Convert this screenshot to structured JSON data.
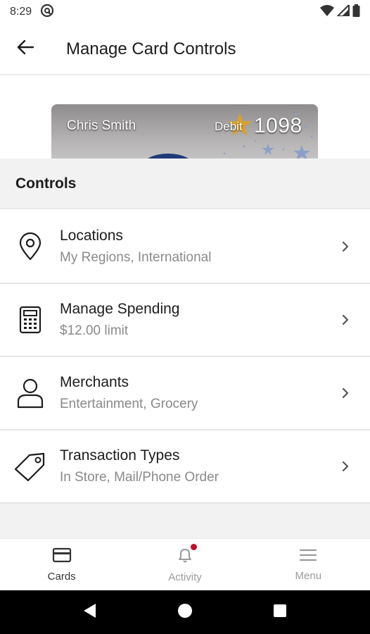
{
  "status_bar": {
    "time": "8:29"
  },
  "header": {
    "title": "Manage Card Controls"
  },
  "card": {
    "name": "Chris Smith",
    "type": "Debit",
    "last4": "1098"
  },
  "section": {
    "title": "Controls"
  },
  "controls": [
    {
      "title": "Locations",
      "subtitle": "My Regions, International",
      "icon": "location-pin-icon"
    },
    {
      "title": "Manage Spending",
      "subtitle": "$12.00 limit",
      "icon": "calculator-icon"
    },
    {
      "title": "Merchants",
      "subtitle": "Entertainment, Grocery",
      "icon": "person-icon"
    },
    {
      "title": "Transaction Types",
      "subtitle": "In Store, Mail/Phone Order",
      "icon": "tag-icon"
    }
  ],
  "bottom_nav": [
    {
      "label": "Cards",
      "icon": "card-icon",
      "active": true
    },
    {
      "label": "Activity",
      "icon": "bell-icon",
      "active": false,
      "badge": true
    },
    {
      "label": "Menu",
      "icon": "hamburger-icon",
      "active": false
    }
  ],
  "colors": {
    "badge": "#c0102a",
    "inactive": "#9a9a9a",
    "card_logo": "#1e3a78",
    "star_gold": "#d8a030",
    "star_blue": "#8aa0c8"
  }
}
